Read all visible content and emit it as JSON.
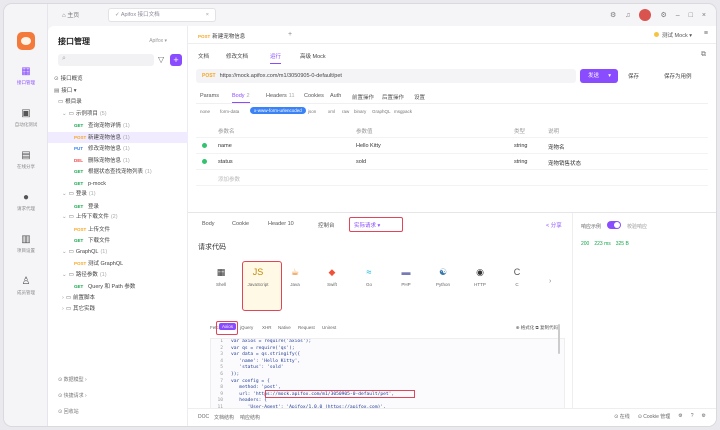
{
  "topbar": {
    "home_label": "⌂ 主页",
    "project_tab": "✓ Apifox 接口文档",
    "icons": [
      "gear-icon",
      "bell-icon",
      "avatar",
      "minimize-icon",
      "maximize-icon",
      "close-icon"
    ]
  },
  "rail": [
    {
      "label": "接口管理",
      "icon": "▦"
    },
    {
      "label": "自动化测试",
      "icon": "▣"
    },
    {
      "label": "在线分享",
      "icon": "▤"
    },
    {
      "label": "请求代理",
      "icon": "●"
    },
    {
      "label": "项目设置",
      "icon": "▥"
    },
    {
      "label": "成员管理",
      "icon": "♙"
    }
  ],
  "sidebar": {
    "title": "接口管理",
    "user": "Apifox ▾",
    "search_placeholder": "",
    "tree": [
      {
        "indent": 6,
        "arrow": "",
        "folder": "⊙",
        "label": "接口概览",
        "method": "",
        "count": ""
      },
      {
        "indent": 6,
        "arrow": "",
        "folder": "▤",
        "label": "接口 ▾",
        "method": "",
        "count": ""
      },
      {
        "indent": 10,
        "arrow": "",
        "folder": "▭",
        "label": "根目录",
        "method": "",
        "count": ""
      },
      {
        "indent": 14,
        "arrow": "⌄",
        "folder": "▭",
        "label": "示例项目",
        "method": "",
        "count": "(5)"
      },
      {
        "indent": 26,
        "arrow": "",
        "folder": "",
        "label": "查询宠物详情",
        "method": "GET",
        "count": "(1)"
      },
      {
        "indent": 26,
        "arrow": "",
        "folder": "",
        "label": "新建宠物信息",
        "method": "POST",
        "count": "(1)",
        "selected": true
      },
      {
        "indent": 26,
        "arrow": "",
        "folder": "",
        "label": "修改宠物信息",
        "method": "PUT",
        "count": "(1)"
      },
      {
        "indent": 26,
        "arrow": "",
        "folder": "",
        "label": "删除宠物信息",
        "method": "DEL",
        "count": "(1)"
      },
      {
        "indent": 26,
        "arrow": "",
        "folder": "",
        "label": "根据状态查找宠物列表",
        "method": "GET",
        "count": "(1)"
      },
      {
        "indent": 26,
        "arrow": "",
        "folder": "",
        "label": "p-mock",
        "method": "GET",
        "count": ""
      },
      {
        "indent": 14,
        "arrow": "⌄",
        "folder": "▭",
        "label": "登录",
        "method": "",
        "count": "(1)"
      },
      {
        "indent": 26,
        "arrow": "",
        "folder": "",
        "label": "登录",
        "method": "GET",
        "count": ""
      },
      {
        "indent": 14,
        "arrow": "⌄",
        "folder": "▭",
        "label": "上传下载文件",
        "method": "",
        "count": "(2)"
      },
      {
        "indent": 26,
        "arrow": "",
        "folder": "",
        "label": "上传文件",
        "method": "POST",
        "count": ""
      },
      {
        "indent": 26,
        "arrow": "",
        "folder": "",
        "label": "下载文件",
        "method": "GET",
        "count": ""
      },
      {
        "indent": 14,
        "arrow": "⌄",
        "folder": "▭",
        "label": "GraphQL",
        "method": "",
        "count": "(1)"
      },
      {
        "indent": 26,
        "arrow": "",
        "folder": "",
        "label": "测试 GraphQL",
        "method": "POST",
        "count": ""
      },
      {
        "indent": 14,
        "arrow": "⌄",
        "folder": "▭",
        "label": "路径参数",
        "method": "",
        "count": "(1)"
      },
      {
        "indent": 26,
        "arrow": "",
        "folder": "",
        "label": "Query 和 Path 参数",
        "method": "GET",
        "count": ""
      },
      {
        "indent": 14,
        "arrow": "›",
        "folder": "▭",
        "label": "前置脚本",
        "method": "",
        "count": ""
      },
      {
        "indent": 14,
        "arrow": "›",
        "folder": "▭",
        "label": "其它实践",
        "method": "",
        "count": ""
      }
    ],
    "footer": [
      "⊙ 数据模型 ›",
      "⊙ 快捷请求 ›",
      "⊙ 回收站"
    ]
  },
  "main": {
    "doc_tab_badge": "POST",
    "doc_tab": "新建宠物信息",
    "doc_tab_plus": "+",
    "env": "测试 Mock",
    "sub_tabs": [
      "文档",
      "修改文档",
      "运行",
      "高级 Mock"
    ],
    "url_method": "POST",
    "url": "https://mock.apifox.com/m1/3050905-0-default/pet",
    "send": "发送",
    "save": "保存",
    "save_as": "保存为用例",
    "req_tabs": [
      {
        "label": "Params",
        "n": ""
      },
      {
        "label": "Body",
        "n": "2"
      },
      {
        "label": "Headers",
        "n": "11"
      },
      {
        "label": "Cookies",
        "n": ""
      },
      {
        "label": "Auth",
        "n": ""
      },
      {
        "label": "前置操作",
        "n": ""
      },
      {
        "label": "后置操作",
        "n": ""
      },
      {
        "label": "设置",
        "n": ""
      }
    ],
    "body_types": [
      "none",
      "form-data",
      "x-www-form-urlencoded",
      "json",
      "xml",
      "raw",
      "binary",
      "GraphQL",
      "msgpack"
    ],
    "param_head": [
      "参数名",
      "参数值",
      "类型",
      "说明"
    ],
    "params": [
      {
        "name": "name",
        "value": "Hello Kitty",
        "type": "string",
        "desc": "宠物名"
      },
      {
        "name": "status",
        "value": "sold",
        "type": "string",
        "desc": "宠物销售状态"
      }
    ],
    "add_param": "添加参数"
  },
  "response": {
    "tabs": [
      "Body",
      "Cookie",
      "Header 10",
      "控制台",
      "实际请求 ▾"
    ],
    "share": "< 分享",
    "code_title": "请求代码",
    "langs": [
      {
        "icon": "▦",
        "label": "Shell"
      },
      {
        "icon": "JS",
        "label": "JavaScript"
      },
      {
        "icon": "☕",
        "label": "Java"
      },
      {
        "icon": "◆",
        "label": "Swift"
      },
      {
        "icon": "≈",
        "label": "Go"
      },
      {
        "icon": "▬",
        "label": "PHP"
      },
      {
        "icon": "☯",
        "label": "Python"
      },
      {
        "icon": "◉",
        "label": "HTTP"
      },
      {
        "icon": "C",
        "label": "C"
      }
    ],
    "lang_more": "›",
    "code_tabs": [
      "Fetch",
      "Axios",
      "jQuery",
      "XHR",
      "Native",
      "Request",
      "Unirest"
    ],
    "code_tab_right": "⊕ 格式化   ⧉ 复制代码",
    "code_lines": [
      "var axios = require('axios');",
      "var qs = require('qs');",
      "var data = qs.stringify({",
      "   'name': 'Hello Kitty',",
      "   'status': 'sold'",
      "});",
      "var config = {",
      "   method: 'post',",
      "   url: 'https://mock.apifox.com/m1/3050905-0-default/pet',",
      "   headers: {",
      "      'User-Agent': 'Apifox/1.0.0 (https://apifox.com)',"
    ],
    "panel_title": "响应示例",
    "panel_mode": "校验响应",
    "status": [
      "200",
      "223 ms",
      "325 B"
    ]
  },
  "statusbar": {
    "left": [
      "DOC",
      "文档结构",
      "响应结构"
    ],
    "right": [
      "⊙ 在线",
      "⊙ Cookie 管理",
      "⚙",
      "? ",
      "⚙"
    ]
  }
}
